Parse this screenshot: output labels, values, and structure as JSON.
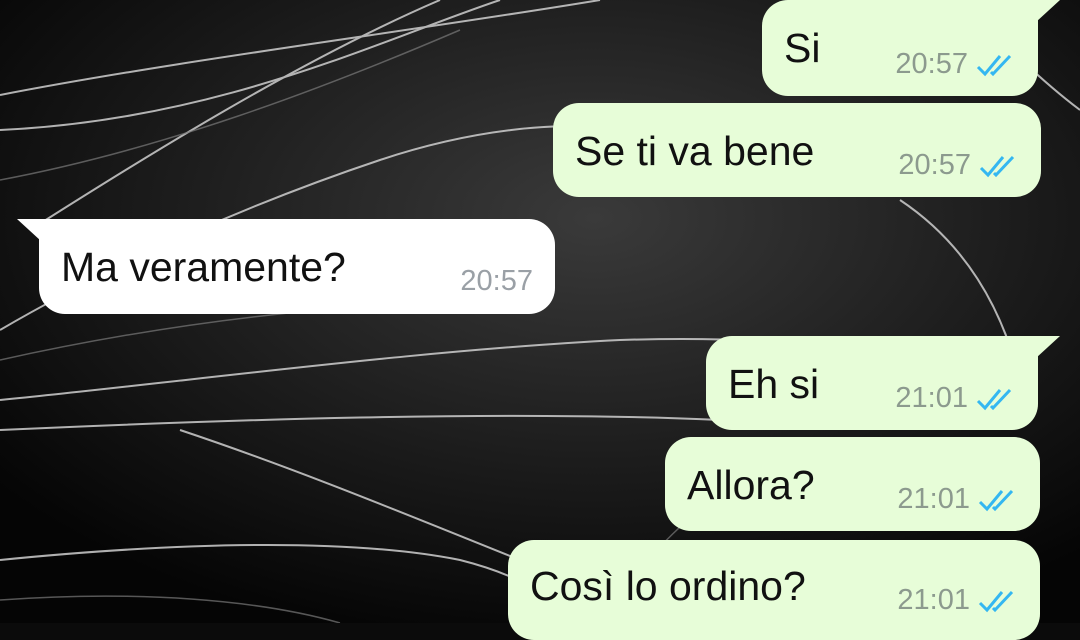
{
  "messages": [
    {
      "direction": "out",
      "text": "Si",
      "time": "20:57",
      "status_icon": "double-check-read-icon"
    },
    {
      "direction": "out",
      "text": "Se ti va bene",
      "time": "20:57",
      "status_icon": "double-check-read-icon"
    },
    {
      "direction": "in",
      "text": "Ma veramente?",
      "time": "20:57"
    },
    {
      "direction": "out",
      "text": "Eh si",
      "time": "21:01",
      "status_icon": "double-check-read-icon"
    },
    {
      "direction": "out",
      "text": "Allora?",
      "time": "21:01",
      "status_icon": "double-check-read-icon"
    },
    {
      "direction": "out",
      "text": "Così lo ordino?",
      "time": "21:01",
      "status_icon": "double-check-read-icon"
    }
  ],
  "colors": {
    "outgoing_bubble": "#e7fdd8",
    "incoming_bubble": "#ffffff",
    "read_ticks": "#34b7f1",
    "wallpaper": "#0b0b0b"
  }
}
